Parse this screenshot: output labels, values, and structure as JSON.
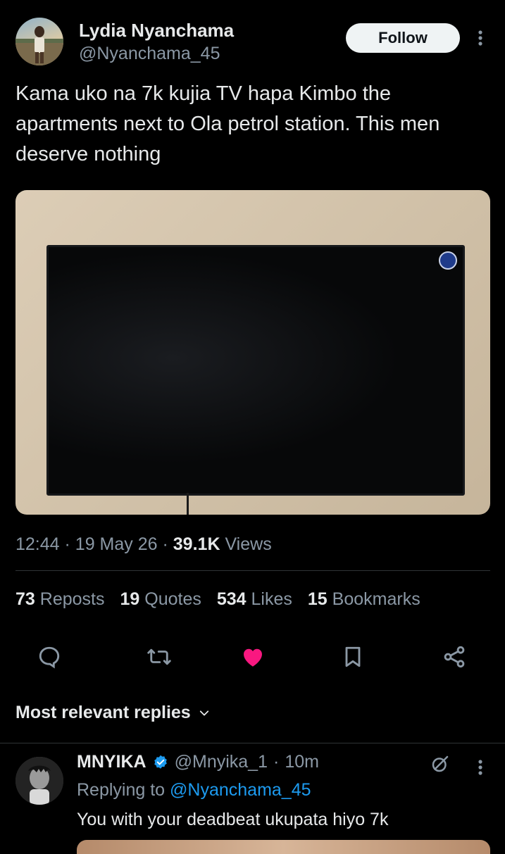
{
  "post": {
    "author_name": "Lydia Nyanchama",
    "author_handle": "@Nyanchama_45",
    "follow_label": "Follow",
    "text": "Kama uko na 7k kujia TV hapa Kimbo the apartments next to Ola petrol station. This men deserve nothing",
    "time": "12:44",
    "date": "19 May 26",
    "views_count": "39.1K",
    "views_label": "Views",
    "separator": "·"
  },
  "stats": [
    {
      "count": "73",
      "label": "Reposts"
    },
    {
      "count": "19",
      "label": "Quotes"
    },
    {
      "count": "534",
      "label": "Likes"
    },
    {
      "count": "15",
      "label": "Bookmarks"
    }
  ],
  "actions": {
    "icons": [
      "reply-icon",
      "repost-icon",
      "like-icon",
      "bookmark-icon",
      "share-icon"
    ],
    "liked": true,
    "like_color": "#f91880",
    "icon_color": "#8b98a5"
  },
  "replies_filter": {
    "label": "Most relevant replies"
  },
  "reply": {
    "author_name": "MNYIKA",
    "verified": true,
    "verified_color": "#1d9bf0",
    "author_handle": "@Mnyika_1",
    "time": "10m",
    "replying_prefix": "Replying to",
    "replying_to": "@Nyanchama_45",
    "text": "You with your deadbeat ukupata hiyo 7k"
  }
}
